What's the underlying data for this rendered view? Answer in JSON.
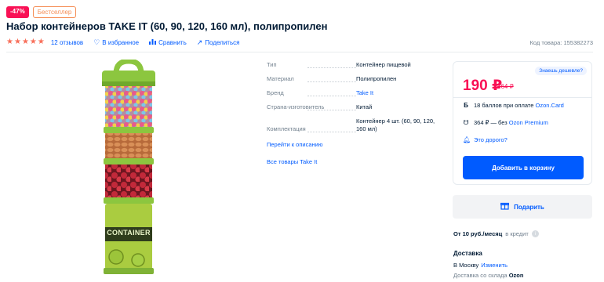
{
  "badges": {
    "discount": "-47%",
    "bestseller": "Бестселлер"
  },
  "product": {
    "title": "Набор контейнеров TAKE IT (60, 90, 120, 160 мл), полипропилен",
    "reviews": "12 отзывов",
    "favorite": "В избранное",
    "compare": "Сравнить",
    "share": "Поделиться",
    "sku": "Код товара: 155382273",
    "rating": 5,
    "image_label": "CONTAINER"
  },
  "characteristics": [
    {
      "label": "Тип",
      "value": "Контейнер пищевой"
    },
    {
      "label": "Материал",
      "value": "Полипропилен"
    },
    {
      "label": "Бренд",
      "value": "Take It"
    },
    {
      "label": "Страна-изготовитель",
      "value": "Китай"
    },
    {
      "label": "Комплектация",
      "value": "Контейнер 4 шт. (60, 90, 120, 160 мл)"
    }
  ],
  "links": {
    "description": "Перейти к описанию",
    "all_brand": "Все товары Take It"
  },
  "price_card": {
    "cheaper": "Знаешь дешевле?",
    "price": "190 ₽",
    "old_price": "364 ₽",
    "perk1_text": "18 баллов при оплате",
    "perk1_link": "Ozon.Card",
    "perk2_text": "364 ₽ — без",
    "perk2_link": "Ozon Premium",
    "perk3_link": "Это дорого?",
    "cart": "Добавить в корзину"
  },
  "gift": "Подарить",
  "credit": {
    "amount": "От 10 руб./месяц",
    "text": "в кредит"
  },
  "delivery": {
    "title": "Доставка",
    "city": "В Москву",
    "change": "Изменить",
    "from": "Доставка со склада",
    "from_brand": "Ozon"
  },
  "colors": {
    "accent": "#005bff",
    "price": "#f91155",
    "star": "#f86f5a",
    "lid": "#8cc63f"
  }
}
